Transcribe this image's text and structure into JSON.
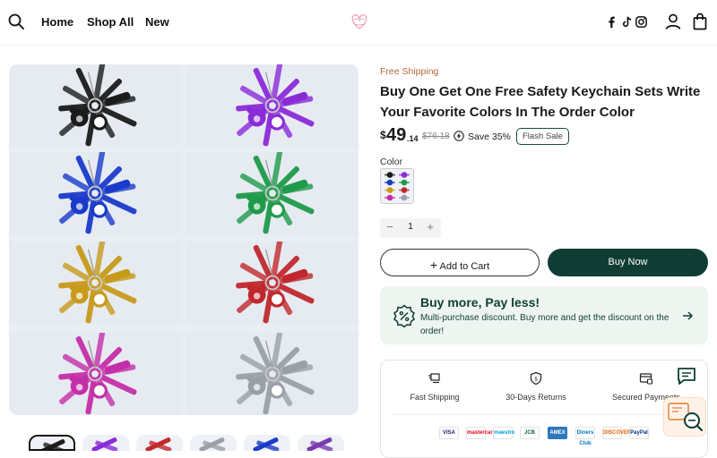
{
  "header": {
    "nav": [
      "Home",
      "Shop All",
      "New"
    ],
    "icons": [
      "search-icon",
      "logo",
      "facebook-icon",
      "tiktok-icon",
      "instagram-icon",
      "account-icon",
      "cart-icon"
    ]
  },
  "product": {
    "shipping_tag": "Free Shipping",
    "title": "Buy One Get One Free Safety Keychain Sets Write Your Favorite Colors In The Order Color",
    "price": {
      "currency": "$",
      "whole": "49",
      "cents": ".14",
      "compare_at": "$76.18",
      "save": "Save 35%",
      "badge": "Flash Sale"
    },
    "option_label": "Color",
    "quantity": "1",
    "qty_minus": "−",
    "qty_plus": "+",
    "add_to_cart": "Add to Cart",
    "buy_now": "Buy Now"
  },
  "promo": {
    "title": "Buy more, Pay less!",
    "text": "Multi-purchase discount. Buy more and get the discount on the order!"
  },
  "trust": [
    {
      "label": "Fast Shipping",
      "icon": "fast-shipping-icon"
    },
    {
      "label": "30-Days Returns",
      "icon": "returns-shield-icon"
    },
    {
      "label": "Secured Payments",
      "icon": "secure-payment-icon"
    }
  ],
  "payments": [
    "VISA",
    "mastercard",
    "maestro",
    "JCB",
    "AMEX",
    "Diners Club",
    "DISCOVER",
    "PayPal"
  ],
  "gallery": {
    "tiles": [
      {
        "color": "#1b1b1b"
      },
      {
        "color": "#8a2bd8"
      },
      {
        "color": "#1a3bc9"
      },
      {
        "color": "#1f9a4a"
      },
      {
        "color": "#c79a1a"
      },
      {
        "color": "#c0282c"
      },
      {
        "color": "#c42ea8"
      },
      {
        "color": "#9aa0a6"
      }
    ],
    "thumb_colors": [
      "#1b1b1b",
      "#8a2bd8",
      "#c0282c",
      "#9aa0a6",
      "#1a3bc9",
      "#7a3bb0"
    ]
  },
  "colors": {
    "brand_dark": "#0f3d33",
    "accent_orange": "#b5653b",
    "promo_bg": "#eef5f1"
  }
}
